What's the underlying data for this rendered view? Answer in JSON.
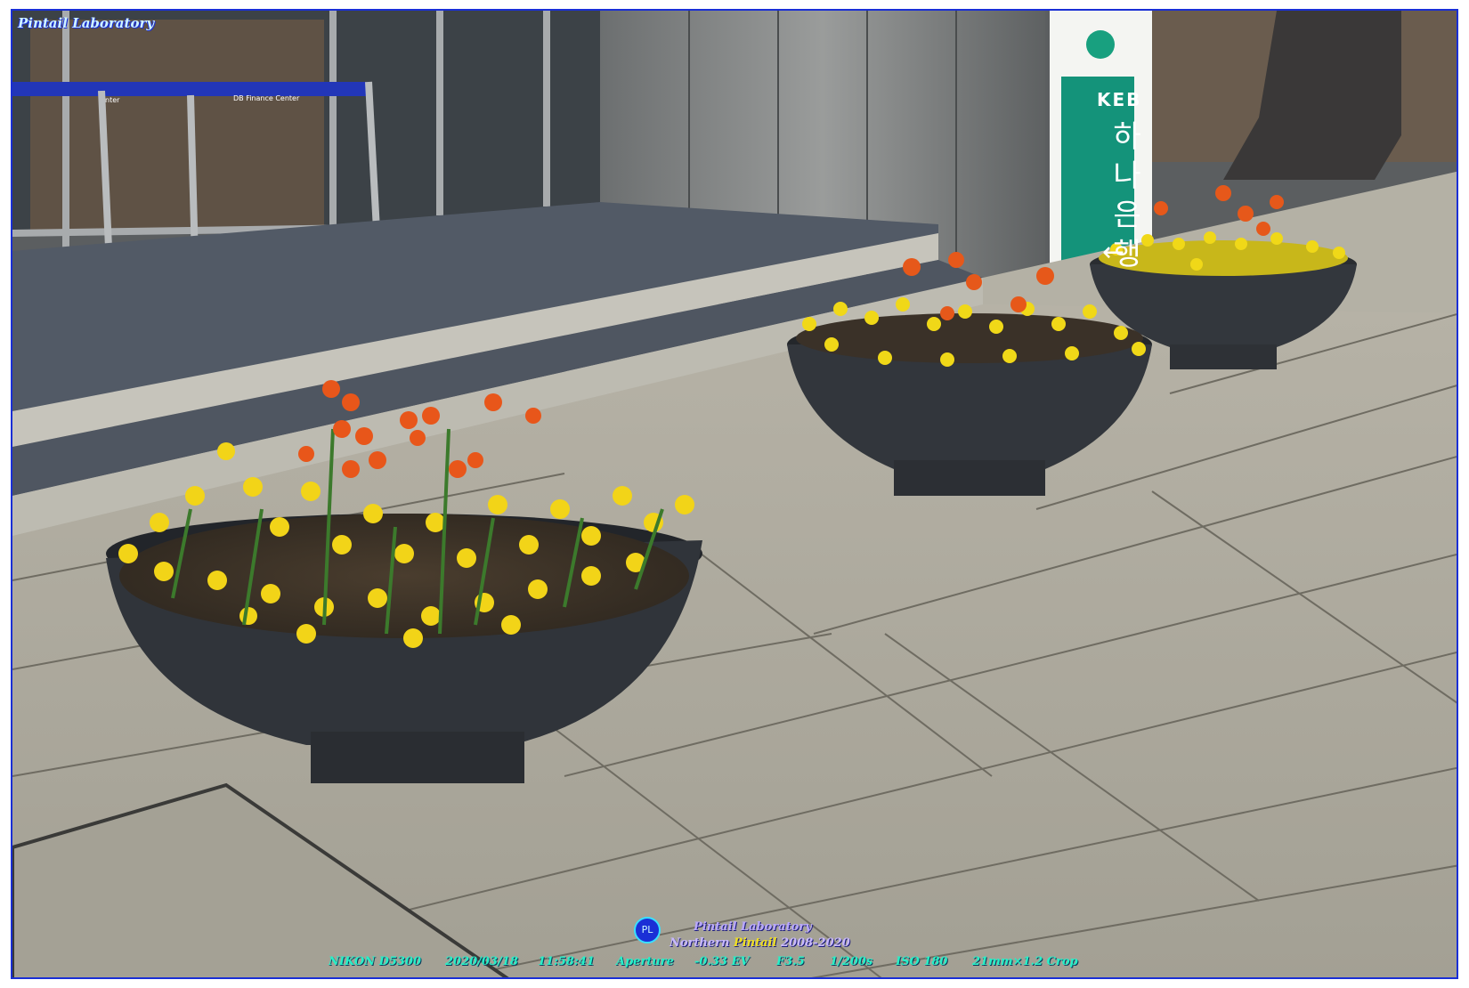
{
  "watermark": {
    "top_left": "Pintail Laboratory",
    "lab": "Pintail Laboratory",
    "line2_a": "Northern ",
    "line2_b": "Pintail",
    "line2_c": " 2008-2020",
    "logo": "PL"
  },
  "exif": {
    "camera": "NIKON D5300",
    "date": "2020/03/18",
    "time": "11:58:41",
    "mode": "Aperture",
    "ev": "-0.33 EV",
    "fstop": "F3.5",
    "shutter": "1/200s",
    "iso": "ISO 180",
    "lens": "21mm×1.2 Crop"
  },
  "sign": {
    "brand": "KEB",
    "korean": [
      "하",
      "나",
      "은",
      "행"
    ],
    "arrow": "←"
  },
  "tape": {
    "label": "DB Finance Center",
    "label_left": "nter"
  },
  "colors": {
    "frame": "#1a2fd6",
    "exif_text": "#27f0c8",
    "sign_green": "#14937a"
  }
}
